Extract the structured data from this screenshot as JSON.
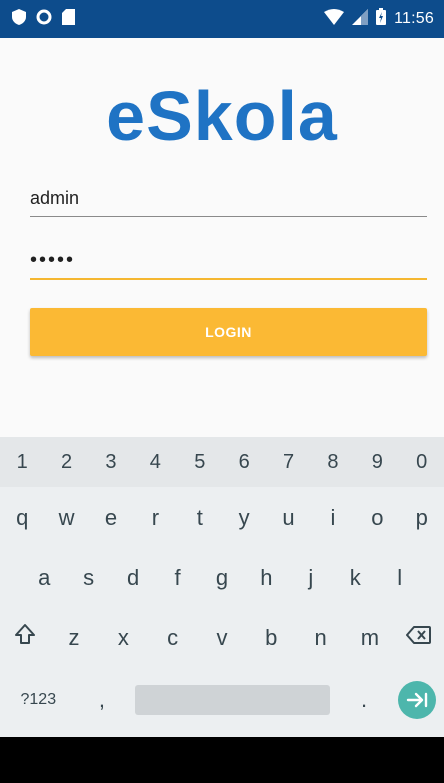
{
  "status_bar": {
    "time": "11:56",
    "icons_left": [
      "shield-icon",
      "circle-icon",
      "sd-card-icon"
    ],
    "icons_right": [
      "wifi-icon",
      "signal-icon",
      "battery-icon"
    ],
    "background": "#0d4c8c"
  },
  "app": {
    "title": "eSkola",
    "title_color": "#1f73c4"
  },
  "login_form": {
    "username_value": "admin",
    "password_value": "•••••",
    "login_label": "LOGIN",
    "accent_color": "#fbb934"
  },
  "keyboard": {
    "number_row": [
      "1",
      "2",
      "3",
      "4",
      "5",
      "6",
      "7",
      "8",
      "9",
      "0"
    ],
    "row_q": [
      "q",
      "w",
      "e",
      "r",
      "t",
      "y",
      "u",
      "i",
      "o",
      "p"
    ],
    "row_a": [
      "a",
      "s",
      "d",
      "f",
      "g",
      "h",
      "j",
      "k",
      "l"
    ],
    "row_z": [
      "z",
      "x",
      "c",
      "v",
      "b",
      "n",
      "m"
    ],
    "symbols_label": "?123",
    "comma": ",",
    "period": ".",
    "icons": [
      "shift-icon",
      "backspace-icon",
      "enter-icon"
    ],
    "enter_color": "#4db6ac"
  }
}
